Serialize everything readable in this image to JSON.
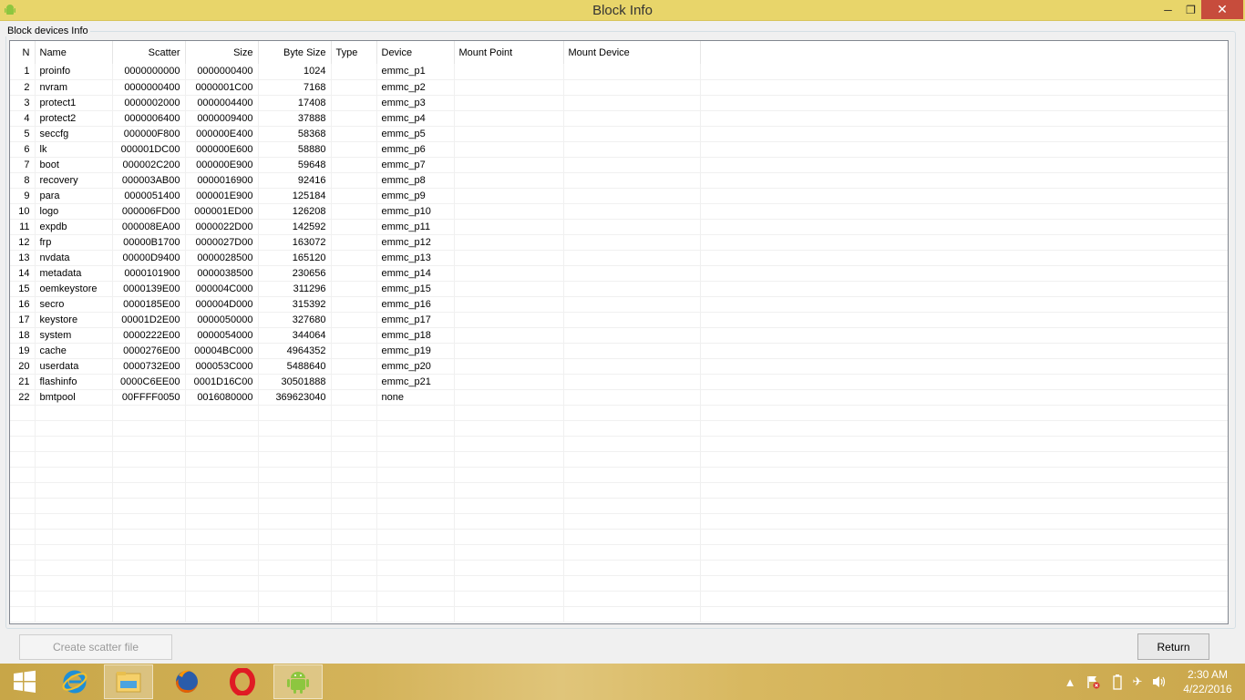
{
  "window": {
    "title": "Block Info",
    "minimize": "─",
    "maximize": "❐",
    "close": "✕"
  },
  "group": {
    "legend": "Block devices Info"
  },
  "table": {
    "columns": [
      "N",
      "Name",
      "Scatter",
      "Size",
      "Byte Size",
      "Type",
      "Device",
      "Mount Point",
      "Mount Device"
    ],
    "rows": [
      [
        "1",
        "proinfo",
        "0000000000",
        "0000000400",
        "1024",
        "",
        "emmc_p1",
        "",
        ""
      ],
      [
        "2",
        "nvram",
        "0000000400",
        "0000001C00",
        "7168",
        "",
        "emmc_p2",
        "",
        ""
      ],
      [
        "3",
        "protect1",
        "0000002000",
        "0000004400",
        "17408",
        "",
        "emmc_p3",
        "",
        ""
      ],
      [
        "4",
        "protect2",
        "0000006400",
        "0000009400",
        "37888",
        "",
        "emmc_p4",
        "",
        ""
      ],
      [
        "5",
        "seccfg",
        "000000F800",
        "000000E400",
        "58368",
        "",
        "emmc_p5",
        "",
        ""
      ],
      [
        "6",
        "lk",
        "000001DC00",
        "000000E600",
        "58880",
        "",
        "emmc_p6",
        "",
        ""
      ],
      [
        "7",
        "boot",
        "000002C200",
        "000000E900",
        "59648",
        "",
        "emmc_p7",
        "",
        ""
      ],
      [
        "8",
        "recovery",
        "000003AB00",
        "0000016900",
        "92416",
        "",
        "emmc_p8",
        "",
        ""
      ],
      [
        "9",
        "para",
        "0000051400",
        "000001E900",
        "125184",
        "",
        "emmc_p9",
        "",
        ""
      ],
      [
        "10",
        "logo",
        "000006FD00",
        "000001ED00",
        "126208",
        "",
        "emmc_p10",
        "",
        ""
      ],
      [
        "11",
        "expdb",
        "000008EA00",
        "0000022D00",
        "142592",
        "",
        "emmc_p11",
        "",
        ""
      ],
      [
        "12",
        "frp",
        "00000B1700",
        "0000027D00",
        "163072",
        "",
        "emmc_p12",
        "",
        ""
      ],
      [
        "13",
        "nvdata",
        "00000D9400",
        "0000028500",
        "165120",
        "",
        "emmc_p13",
        "",
        ""
      ],
      [
        "14",
        "metadata",
        "0000101900",
        "0000038500",
        "230656",
        "",
        "emmc_p14",
        "",
        ""
      ],
      [
        "15",
        "oemkeystore",
        "0000139E00",
        "000004C000",
        "311296",
        "",
        "emmc_p15",
        "",
        ""
      ],
      [
        "16",
        "secro",
        "0000185E00",
        "000004D000",
        "315392",
        "",
        "emmc_p16",
        "",
        ""
      ],
      [
        "17",
        "keystore",
        "00001D2E00",
        "0000050000",
        "327680",
        "",
        "emmc_p17",
        "",
        ""
      ],
      [
        "18",
        "system",
        "0000222E00",
        "0000054000",
        "344064",
        "",
        "emmc_p18",
        "",
        ""
      ],
      [
        "19",
        "cache",
        "0000276E00",
        "00004BC000",
        "4964352",
        "",
        "emmc_p19",
        "",
        ""
      ],
      [
        "20",
        "userdata",
        "0000732E00",
        "000053C000",
        "5488640",
        "",
        "emmc_p20",
        "",
        ""
      ],
      [
        "21",
        "flashinfo",
        "0000C6EE00",
        "0001D16C00",
        "30501888",
        "",
        "emmc_p21",
        "",
        ""
      ],
      [
        "22",
        "bmtpool",
        "00FFFF0050",
        "0016080000",
        "369623040",
        "",
        "none",
        "",
        ""
      ]
    ],
    "empty_rows": 14
  },
  "buttons": {
    "create_scatter": "Create scatter file",
    "return": "Return"
  },
  "taskbar": {
    "items": [
      "start-icon",
      "internet-explorer-icon",
      "file-explorer-icon",
      "firefox-icon",
      "opera-icon",
      "android-tool-icon"
    ],
    "active": "android-tool-icon",
    "time": "2:30 AM",
    "date": "4/22/2016"
  },
  "colors": {
    "titlebar": "#e8d56a",
    "close": "#c74c3c",
    "taskbar": "#d4b35a"
  }
}
